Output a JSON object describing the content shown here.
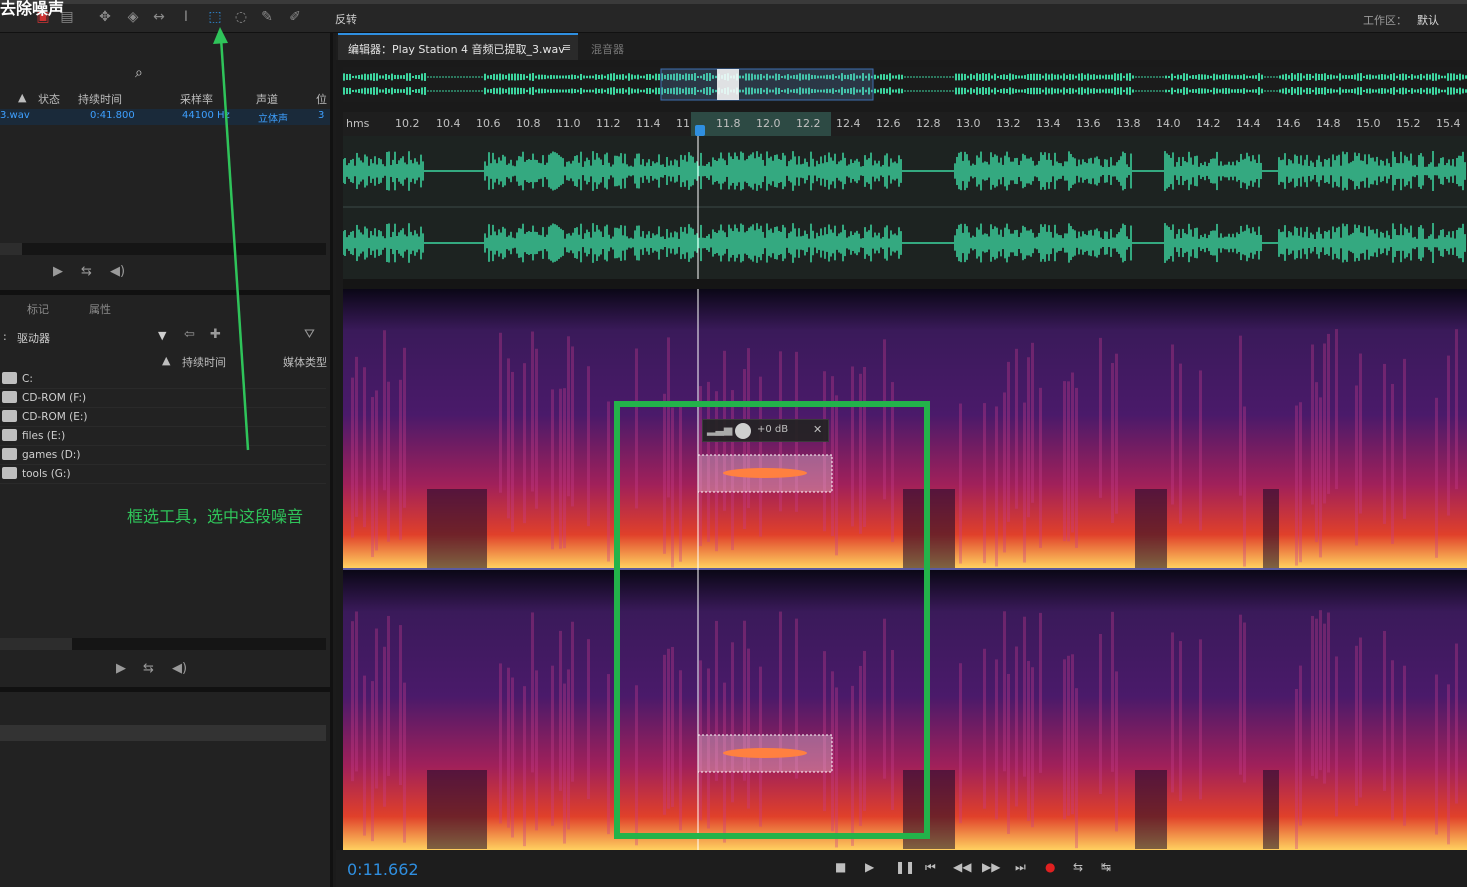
{
  "toolbar": {
    "overlay_title": "去除噪声",
    "reverse_label": "反转",
    "workspace_label": "工作区：",
    "workspace_value": "默认"
  },
  "files_panel": {
    "columns": [
      "状态",
      "持续时间",
      "采样率",
      "声道",
      "位"
    ],
    "file": {
      "name": "3.wav",
      "duration": "0:41.800",
      "sample_rate": "44100 Hz",
      "channels": "立体声",
      "bit": "3"
    }
  },
  "media_panel": {
    "tabs": [
      "标记",
      "属性"
    ],
    "location_label": "驱动器",
    "columns": [
      "持续时间",
      "媒体类型"
    ],
    "drives": [
      "C:",
      "CD-ROM (F:)",
      "CD-ROM (E:)",
      "files (E:)",
      "games (D:)",
      "tools (G:)"
    ]
  },
  "annotation": "框选工具，选中这段噪音",
  "editor": {
    "tab_title": "编辑器：Play Station 4 音频已提取_3.wav",
    "tab_menu": "≡",
    "mixer_tab": "混音器",
    "ruler_unit": "hms",
    "ruler_ticks": [
      "10.2",
      "10.4",
      "10.6",
      "10.8",
      "11.0",
      "11.2",
      "11.4",
      "11",
      "11.8",
      "12.0",
      "12.2",
      "12.4",
      "12.6",
      "12.8",
      "13.0",
      "13.2",
      "13.4",
      "13.6",
      "13.8",
      "14.0",
      "14.2",
      "14.4",
      "14.6",
      "14.8",
      "15.0",
      "15.2",
      "15.4"
    ],
    "hud_gain": "+0 dB",
    "timecode": "0:11.662"
  },
  "colors": {
    "accent": "#2f8fe0",
    "waveform": "#3dd6a0",
    "annotation": "#2fc45a"
  }
}
